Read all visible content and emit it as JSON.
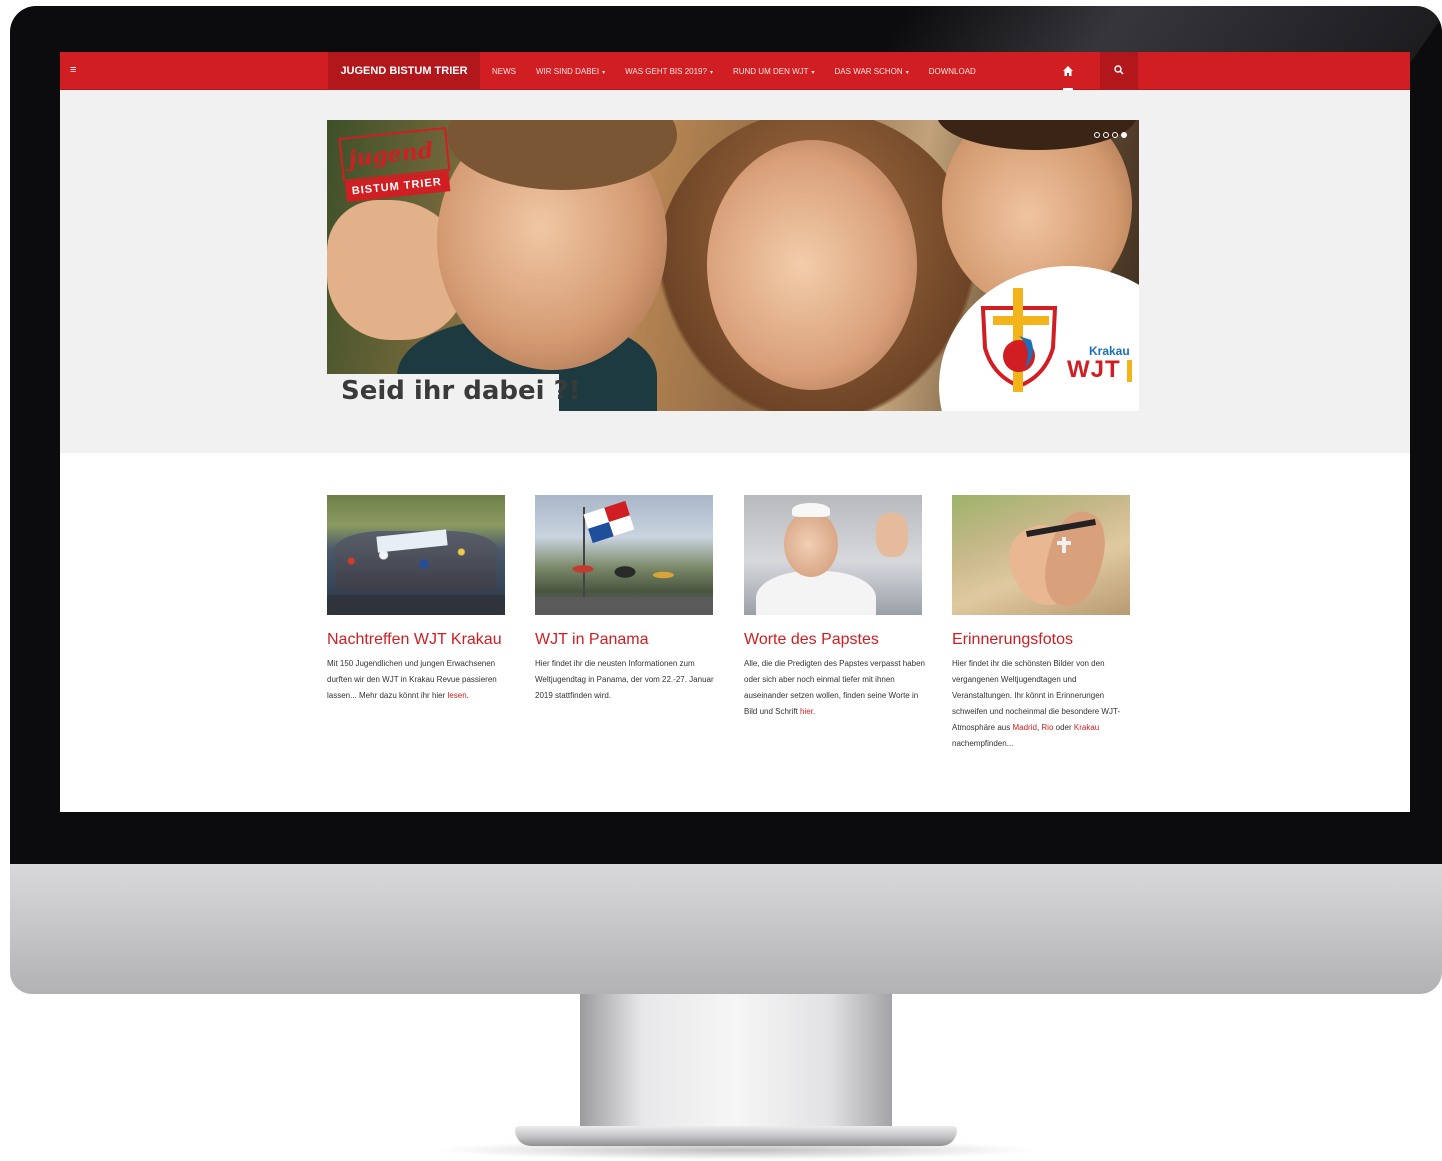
{
  "navbar": {
    "brand": "JUGEND BISTUM TRIER",
    "items": [
      {
        "label": "NEWS",
        "dropdown": false
      },
      {
        "label": "WIR SIND DABEI",
        "dropdown": true
      },
      {
        "label": "WAS GEHT BIS 2019?",
        "dropdown": true
      },
      {
        "label": "RUND UM DEN WJT",
        "dropdown": true
      },
      {
        "label": "DAS WAR SCHON",
        "dropdown": true
      },
      {
        "label": "DOWNLOAD",
        "dropdown": false
      }
    ],
    "dropdown_caret": "▾",
    "menu_icon": "hamburger-icon",
    "home_icon": "home-icon",
    "search_icon": "search-icon",
    "accent_color": "#d01e22"
  },
  "hero": {
    "caption": "Seid ihr dabei ?!",
    "logo_jugend": "jugend",
    "logo_bistum": "BISTUM TRIER",
    "wjt_city": "Krakau",
    "wjt_label": "WJT",
    "slides_total": 4,
    "slide_active": 4
  },
  "cards": [
    {
      "title": "Nachtreffen WJT Krakau",
      "text": "Mit 150 Jugendlichen und jungen Erwachsenen durften wir den WJT in Krakau Revue passieren lassen... Mehr dazu könnt ihr hier ",
      "link": "lesen",
      "tail": "."
    },
    {
      "title": "WJT in Panama",
      "text": "Hier findet ihr die neusten Informationen zum Weltjugendtag in Panama, der vom 22.-27. Januar 2019 stattfinden wird.",
      "link": "",
      "tail": ""
    },
    {
      "title": "Worte des Papstes",
      "text": "Alle, die die Predigten des Papstes verpasst haben oder sich aber noch einmal tiefer mit ihnen auseinander setzen wollen, finden seine Worte in Bild und Schrift ",
      "link": "hier",
      "tail": "."
    },
    {
      "title": "Erinnerungsfotos",
      "text": "Hier findet ihr die schönsten Bilder von den vergangenen Weltjugendtagen und Veranstaltungen. Ihr könnt in Erinnerungen schweifen und nocheinmal die besondere WJT-Atmosphäre aus ",
      "link": "Madrid",
      "sep1": ", ",
      "link2": "Rio",
      "sep2": " oder ",
      "link3": "Krakau",
      "tail": " nachempfinden..."
    }
  ]
}
